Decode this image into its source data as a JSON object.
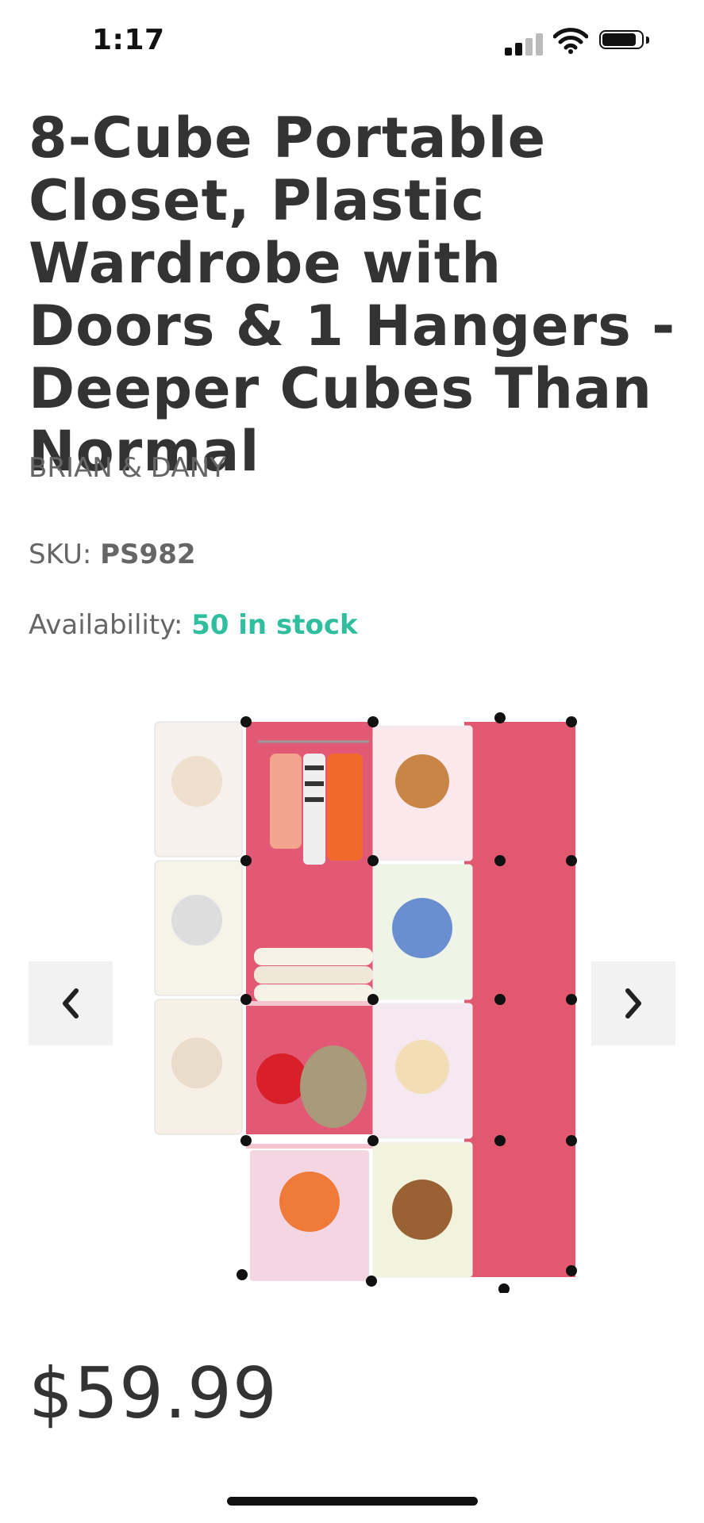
{
  "status_bar": {
    "time": "1:17",
    "signal_icon": "cellular-signal-icon",
    "wifi_icon": "wifi-icon",
    "battery_icon": "battery-icon"
  },
  "product": {
    "title": "8-Cube Portable Closet, Plastic Wardrobe with Doors & 1 Hangers - Deeper Cubes Than Normal",
    "brand": "BRIAN & DANY",
    "sku_label": "SKU:",
    "sku_value": "PS982",
    "availability_label": "Availability:",
    "availability_value": "50 in stock",
    "price": "$59.99"
  },
  "gallery": {
    "image_name": "pink-8-cube-wardrobe-image",
    "prev_icon": "chevron-left-icon",
    "next_icon": "chevron-right-icon"
  },
  "colors": {
    "accent_stock": "#2fbf9e",
    "text": "#333333",
    "muted": "#666666",
    "wardrobe_pink": "#e8647e"
  }
}
